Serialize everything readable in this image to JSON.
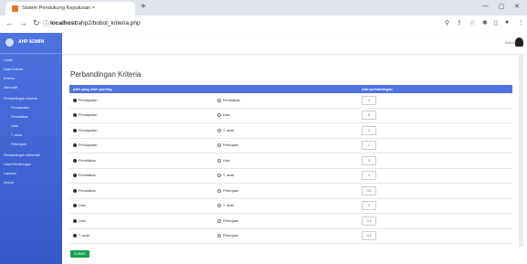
{
  "browser": {
    "tab_title": "Sistem Pendukung Keputusan ×",
    "url_host": "localhost",
    "url_path": "/ahp2/bobot_kriteria.php"
  },
  "sidebar": {
    "brand": "AHP ADMIN",
    "items": [
      {
        "label": "Home"
      },
      {
        "label": "Data Kriteria"
      },
      {
        "label": "Kriteria"
      },
      {
        "label": "Alternatif"
      },
      {
        "label": "Perbandingan Kriteria"
      },
      {
        "label": "Pendapatan",
        "sub": true
      },
      {
        "label": "Pendidikan",
        "sub": true
      },
      {
        "label": "Usia",
        "sub": true
      },
      {
        "label": "T. anak",
        "sub": true
      },
      {
        "label": "Pekerjaan",
        "sub": true
      },
      {
        "label": "Perbandingan Alternatif"
      },
      {
        "label": "Hasil Perhitungan"
      },
      {
        "label": "Laporan"
      },
      {
        "label": "Keluar"
      }
    ]
  },
  "topbar": {
    "user": "Admin"
  },
  "main": {
    "title": "Perbandingan Kriteria",
    "columns": [
      "pilih yang lebih penting",
      "",
      "nilai perbandingan"
    ],
    "rows": [
      {
        "left": "Pendapatan",
        "right": "Pendidikan",
        "value": "3"
      },
      {
        "left": "Pendapatan",
        "right": "Usia",
        "value": "5"
      },
      {
        "left": "Pendapatan",
        "right": "T. anak",
        "value": "3"
      },
      {
        "left": "Pendapatan",
        "right": "Pekerjaan",
        "value": "1"
      },
      {
        "left": "Pendidikan",
        "right": "Usia",
        "value": "3"
      },
      {
        "left": "Pendidikan",
        "right": "T. anak",
        "value": "3"
      },
      {
        "left": "Pendidikan",
        "right": "Pekerjaan",
        "value": "0.5"
      },
      {
        "left": "Usia",
        "right": "T. anak",
        "value": "3"
      },
      {
        "left": "Usia",
        "right": "Pekerjaan",
        "value": "0.5"
      },
      {
        "left": "T. anak",
        "right": "Pekerjaan",
        "value": "0.5"
      }
    ],
    "submit_label": "SUBMIT"
  },
  "colors": {
    "primary": "#4e73df",
    "submit": "#16a34a"
  }
}
